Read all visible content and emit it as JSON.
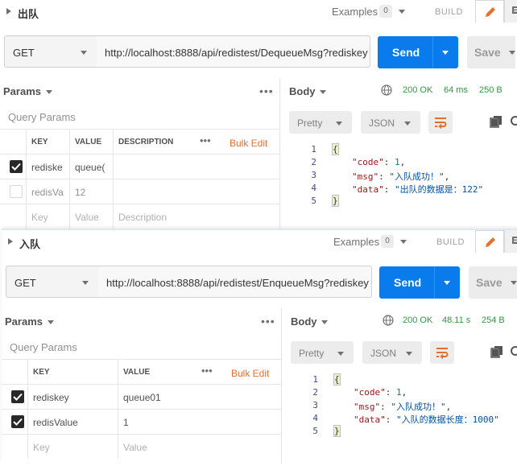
{
  "panels": [
    {
      "name": "出队",
      "examples_label": "Examples",
      "examples_count": "0",
      "build_label": "BUILD",
      "method": "GET",
      "url": "http://localhost:8888/api/redistest/DequeueMsg?rediskey",
      "send_label": "Send",
      "save_label": "Save",
      "params_tab": "Params",
      "query_params_label": "Query Params",
      "columns": [
        "KEY",
        "VALUE",
        "DESCRIPTION"
      ],
      "bulk_edit": "Bulk Edit",
      "rows": [
        {
          "key": "rediske",
          "value": "queue(",
          "checked": true
        },
        {
          "key": "redisVa",
          "value": "12",
          "checked": false
        }
      ],
      "placeholder": {
        "key": "Key",
        "value": "Value",
        "description": "Description"
      },
      "response": {
        "body_tab": "Body",
        "status": "200 OK",
        "time": "64 ms",
        "size": "250 B",
        "format": "Pretty",
        "language": "JSON",
        "line_numbers": [
          "1",
          "2",
          "3",
          "4",
          "5"
        ],
        "json": {
          "open": "{",
          "code_key": "\"code\"",
          "code_val": "1",
          "msg_key": "\"msg\"",
          "msg_val": "\"入队成功！\"",
          "data_key": "\"data\"",
          "data_val": "\"出队的数据是：122\"",
          "close": "}"
        }
      }
    },
    {
      "name": "入队",
      "examples_label": "Examples",
      "examples_count": "0",
      "build_label": "BUILD",
      "method": "GET",
      "url": "http://localhost:8888/api/redistest/EnqueueMsg?rediskey",
      "send_label": "Send",
      "save_label": "Save",
      "params_tab": "Params",
      "query_params_label": "Query Params",
      "columns": [
        "KEY",
        "VALUE"
      ],
      "bulk_edit": "Bulk Edit",
      "rows": [
        {
          "key": "rediskey",
          "value": "queue01",
          "checked": true
        },
        {
          "key": "redisValue",
          "value": "1",
          "checked": true
        }
      ],
      "placeholder": {
        "key": "Key",
        "value": "Value"
      },
      "response": {
        "body_tab": "Body",
        "status": "200 OK",
        "time": "48.11 s",
        "size": "254 B",
        "format": "Pretty",
        "language": "JSON",
        "line_numbers": [
          "1",
          "2",
          "3",
          "4",
          "5"
        ],
        "json": {
          "open": "{",
          "code_key": "\"code\"",
          "code_val": "1",
          "msg_key": "\"msg\"",
          "msg_val": "\"入队成功！\"",
          "data_key": "\"data\"",
          "data_val": "\"入队的数据长度：1000\"",
          "close": "}"
        }
      }
    }
  ],
  "colors": {
    "send": "#097bed",
    "status_ok": "#2f9a3f",
    "bulk_edit": "#e4702e",
    "edit_icon": "#e4702e"
  }
}
